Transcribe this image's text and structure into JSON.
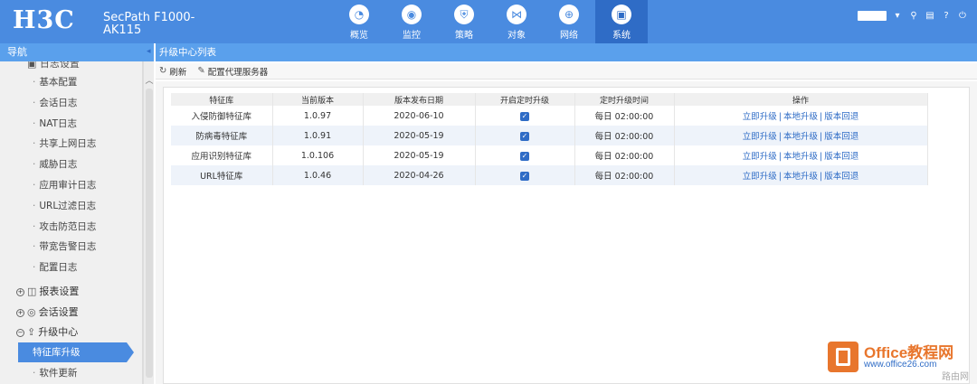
{
  "header": {
    "logo": "H3C",
    "product": "SecPath F1000-AK115",
    "nav": [
      {
        "label": "概览",
        "icon": "gauge-icon",
        "glyph": "◔"
      },
      {
        "label": "监控",
        "icon": "camera-icon",
        "glyph": "◉"
      },
      {
        "label": "策略",
        "icon": "shield-icon",
        "glyph": "⛨"
      },
      {
        "label": "对象",
        "icon": "share-icon",
        "glyph": "⋈"
      },
      {
        "label": "网络",
        "icon": "globe-icon",
        "glyph": "⊕"
      },
      {
        "label": "系统",
        "icon": "monitor-icon",
        "glyph": "▣"
      }
    ],
    "active_nav": "系统"
  },
  "sidebar": {
    "title": "导航",
    "partial_item": "日志设置",
    "items": [
      "基本配置",
      "会话日志",
      "NAT日志",
      "共享上网日志",
      "威胁日志",
      "应用审计日志",
      "URL过滤日志",
      "攻击防范日志",
      "带宽告警日志",
      "配置日志"
    ],
    "groups": [
      "报表设置",
      "会话设置",
      "升级中心"
    ],
    "active_item": "特征库升级",
    "after_item": "软件更新"
  },
  "main": {
    "tab_title": "升级中心列表",
    "toolbar": {
      "refresh": "刷新",
      "proxy": "配置代理服务器"
    },
    "table": {
      "headers": [
        "特征库",
        "当前版本",
        "版本发布日期",
        "开启定时升级",
        "定时升级时间",
        "操作"
      ],
      "rows": [
        {
          "name": "入侵防御特征库",
          "version": "1.0.97",
          "date": "2020-06-10",
          "scheduled": true,
          "time": "每日 02:00:00"
        },
        {
          "name": "防病毒特征库",
          "version": "1.0.91",
          "date": "2020-05-19",
          "scheduled": true,
          "time": "每日 02:00:00"
        },
        {
          "name": "应用识别特征库",
          "version": "1.0.106",
          "date": "2020-05-19",
          "scheduled": true,
          "time": "每日 02:00:00"
        },
        {
          "name": "URL特征库",
          "version": "1.0.46",
          "date": "2020-04-26",
          "scheduled": true,
          "time": "每日 02:00:00"
        }
      ],
      "ops": [
        "立即升级",
        "本地升级",
        "版本回退"
      ]
    }
  },
  "watermark": {
    "title": "Office教程网",
    "url": "www.office26.com",
    "tag": "路由网"
  },
  "colors": {
    "header": "#4a8be0",
    "active": "#2f6cc6",
    "link": "#2f6cc6",
    "watermark": "#e8762d"
  }
}
